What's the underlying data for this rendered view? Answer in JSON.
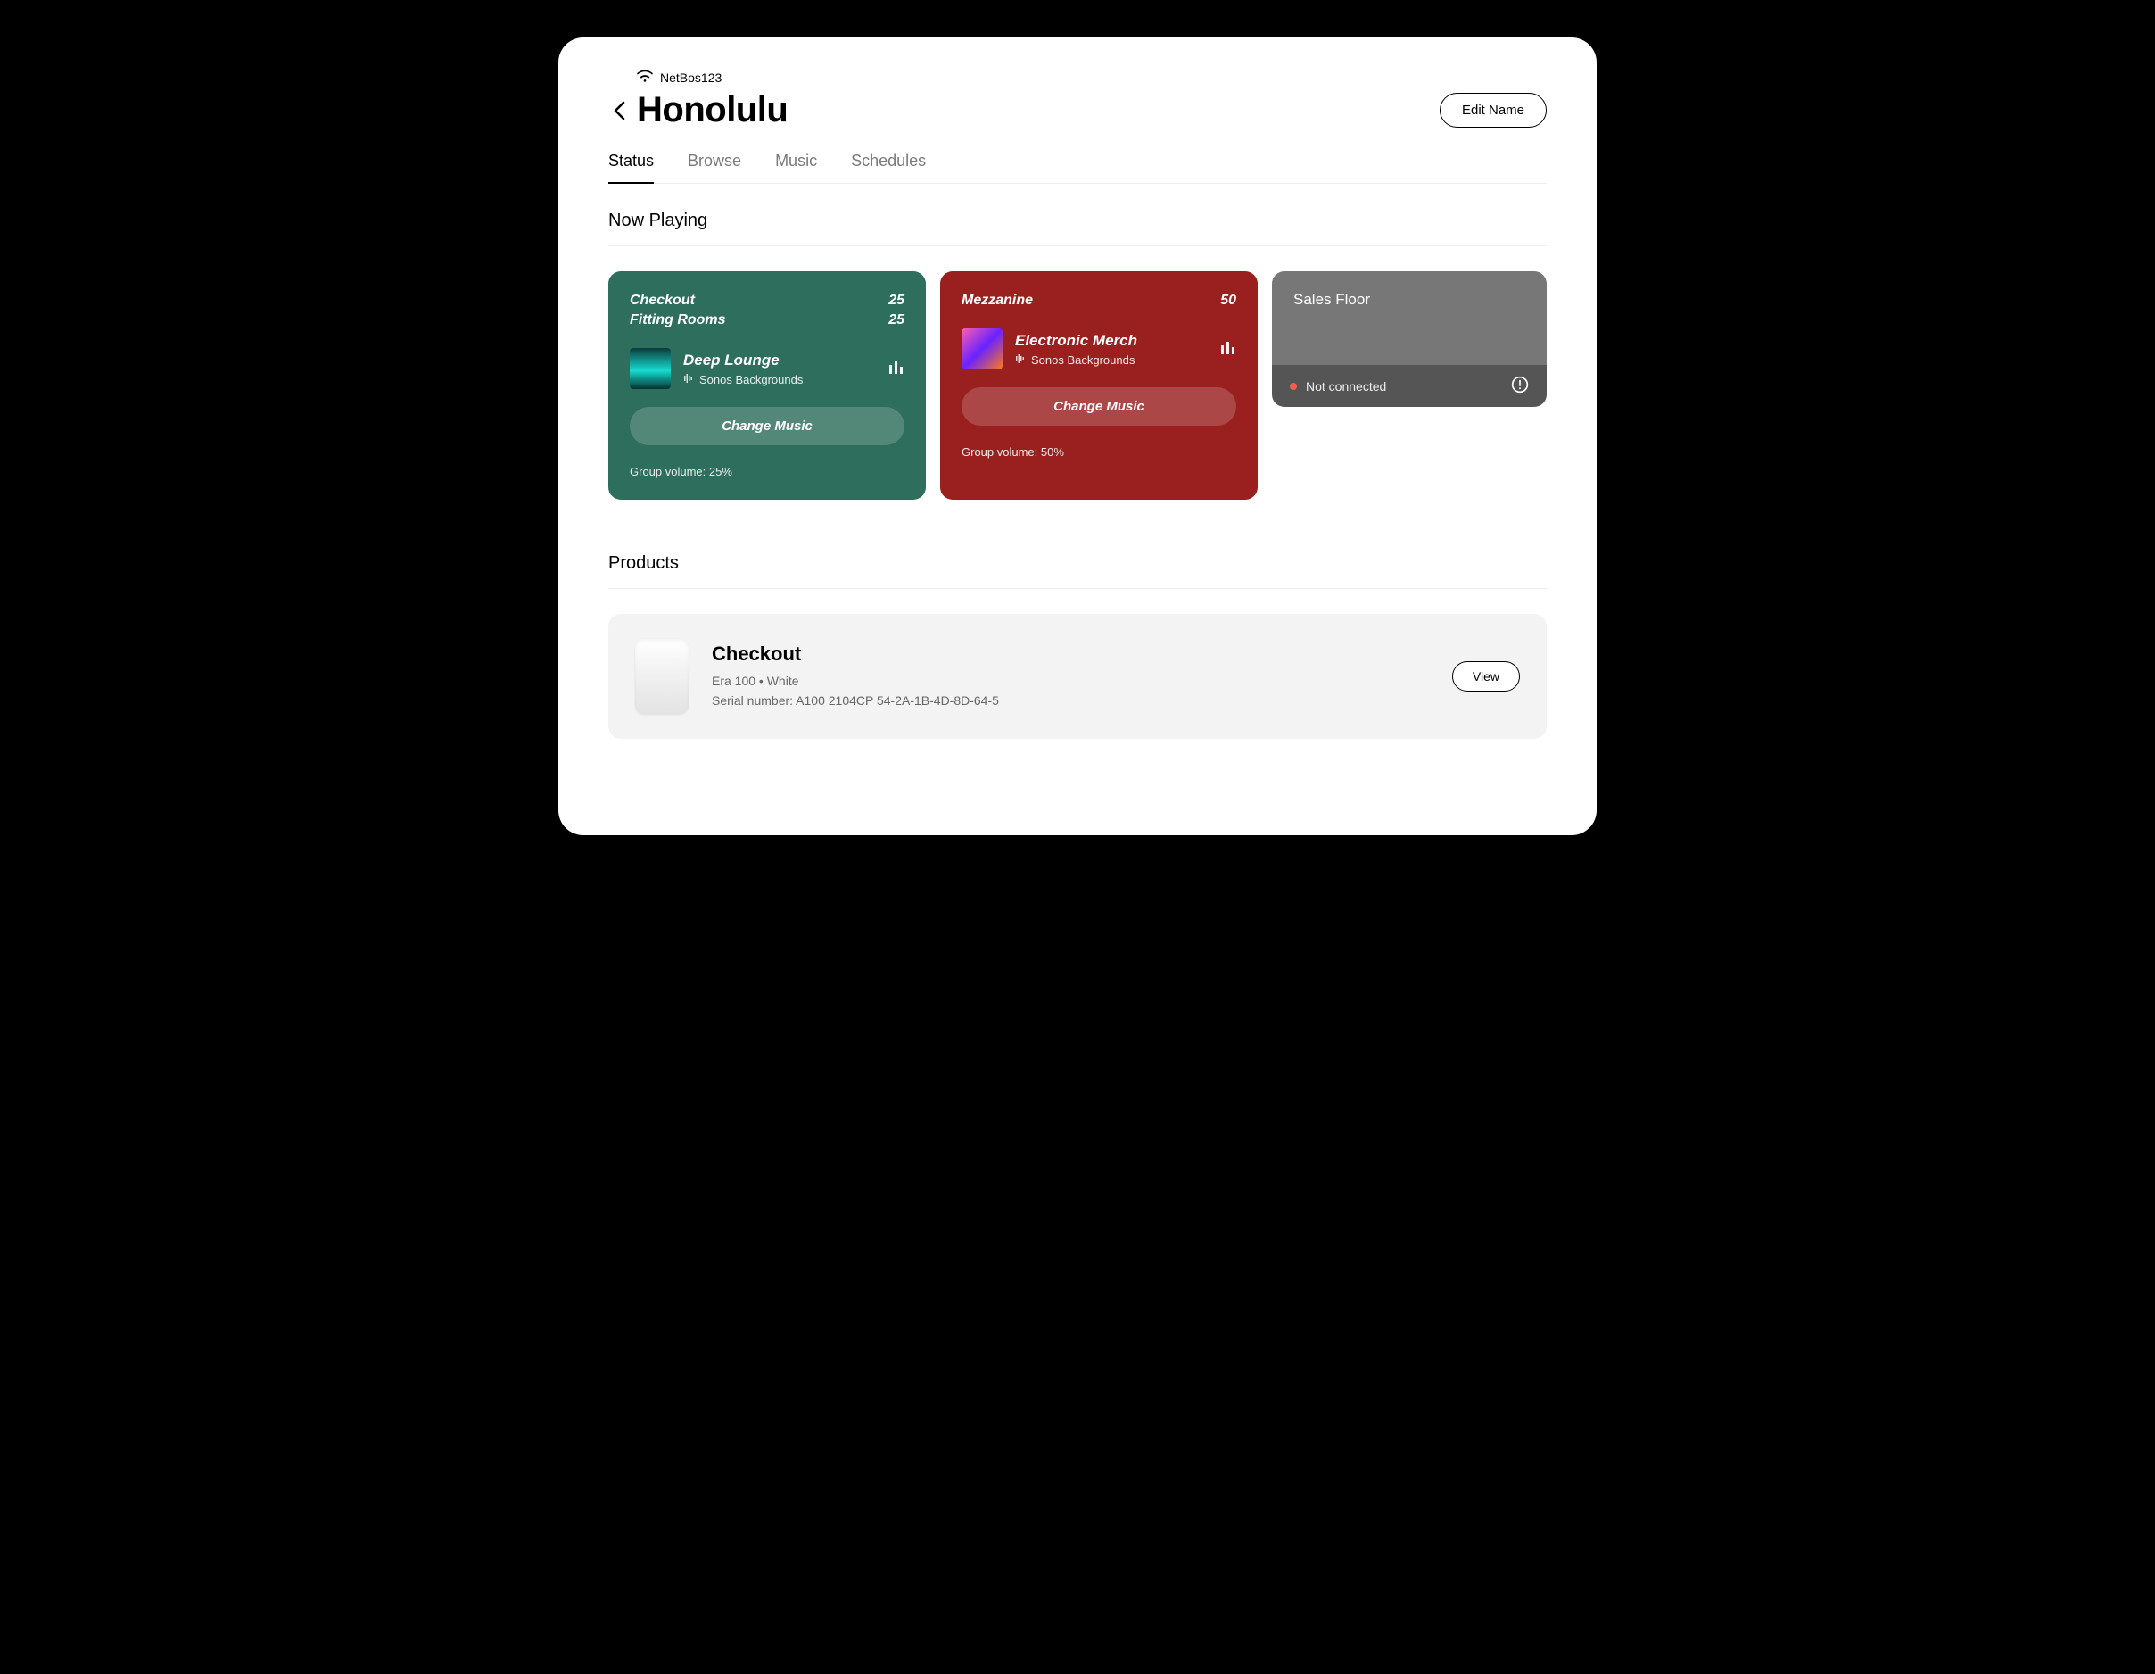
{
  "header": {
    "wifi_name": "NetBos123",
    "page_title": "Honolulu",
    "edit_name_label": "Edit Name"
  },
  "tabs": {
    "status": "Status",
    "browse": "Browse",
    "music": "Music",
    "schedules": "Schedules",
    "active": "status"
  },
  "now_playing": {
    "heading": "Now Playing",
    "cards": [
      {
        "zones": [
          {
            "name": "Checkout",
            "volume": "25"
          },
          {
            "name": "Fitting Rooms",
            "volume": "25"
          }
        ],
        "track_title": "Deep Lounge",
        "track_source": "Sonos Backgrounds",
        "change_label": "Change Music",
        "group_volume_label": "Group volume: 25%"
      },
      {
        "zones": [
          {
            "name": "Mezzanine",
            "volume": "50"
          }
        ],
        "track_title": "Electronic Merch",
        "track_source": "Sonos Backgrounds",
        "change_label": "Change Music",
        "group_volume_label": "Group volume: 50%"
      },
      {
        "title": "Sales Floor",
        "status_text": "Not connected"
      }
    ]
  },
  "products": {
    "heading": "Products",
    "items": [
      {
        "name": "Checkout",
        "model_line": "Era 100 • White",
        "serial_line": "Serial number: A100 2104CP 54-2A-1B-4D-8D-64-5",
        "view_label": "View"
      }
    ]
  }
}
